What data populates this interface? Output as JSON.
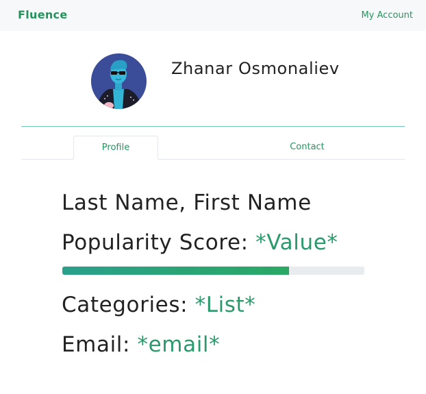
{
  "navbar": {
    "brand": "Fluence",
    "account_link": "My Account"
  },
  "profile": {
    "name": "Zhanar Osmonaliev",
    "avatar_icon": "avatar-illustration"
  },
  "tabs": [
    {
      "label": "Profile",
      "active": true
    },
    {
      "label": "Contact",
      "active": false
    }
  ],
  "fields": {
    "name_label": "Last Name, First Name",
    "popularity_label": "Popularity Score:",
    "popularity_value": "*Value*",
    "popularity_progress": 0.75,
    "categories_label": "Categories:",
    "categories_value": "*List*",
    "email_label": "Email:",
    "email_value": "*email*"
  },
  "colors": {
    "accent": "#26935f",
    "value_text": "#2a9a6c",
    "progress_track": "#e9ecef"
  }
}
